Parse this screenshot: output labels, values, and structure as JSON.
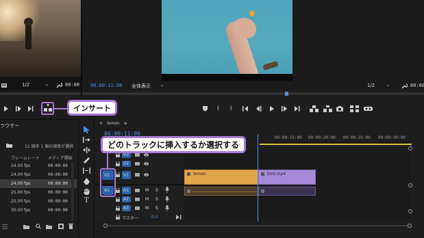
{
  "source_monitor": {
    "zoom": "1/2",
    "timecode": "00:00"
  },
  "program_monitor": {
    "timecode": "00:00:11:06",
    "fit": "全体表示",
    "zoom": "1/2",
    "timecode_right": "00:00"
  },
  "project_panel": {
    "title": "ラウザー",
    "item_info": "11 個中 1 個の項目が選択",
    "col_framerate": "フレームレート",
    "col_media_start": "メディア開始",
    "rows": [
      {
        "fps": "24.00 fps",
        "start": "00:00:00"
      },
      {
        "fps": "24.00 fps",
        "start": "00:00:00"
      },
      {
        "fps": "24.00 fps",
        "start": "00:00:00"
      },
      {
        "fps": "25.00 fps",
        "start": "00:00:00"
      },
      {
        "fps": "25.00 fps",
        "start": "00:00:00"
      },
      {
        "fps": "30.00 fps",
        "start": "00:00:00"
      }
    ]
  },
  "timeline": {
    "sequence_name": "lemon",
    "timecode": "00:00:11:06",
    "ruler": [
      "00:00:15:00",
      "00:00:20:00",
      "00:00:25:00",
      "00:00:30:00"
    ],
    "video_tracks": [
      "V3",
      "V2",
      "V1"
    ],
    "audio_tracks": [
      "A1",
      "A2",
      "A3"
    ],
    "source_v": "V1",
    "source_a": "A1",
    "master_label": "マスター",
    "master_value": "0.0",
    "clips": {
      "lemon_video": "lemon",
      "bird_video": "bird.mp4"
    },
    "track_toggles": {
      "mute": "M",
      "solo": "S"
    }
  },
  "callouts": {
    "insert": "インサート",
    "track_select": "どのトラックに挿入するか選択する"
  },
  "colors": {
    "accent": "#a97ad6",
    "timecode_blue": "#4f8fe6",
    "clip_orange": "#e2a54c",
    "clip_purple": "#a48ad8",
    "track_blue": "#2b63a8"
  }
}
